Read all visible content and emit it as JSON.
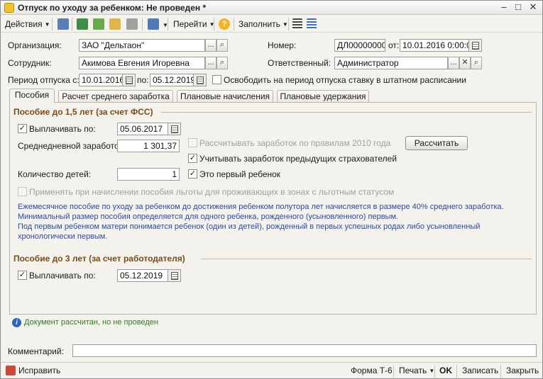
{
  "window": {
    "title": "Отпуск по уходу за ребенком: Не проведен *",
    "minimize": "–",
    "maximize": "□",
    "close": "✕"
  },
  "toolbar": {
    "actions_label": "Действия",
    "goto_label": "Перейти",
    "fill_label": "Заполнить",
    "help_glyph": "?"
  },
  "header": {
    "org_label": "Организация:",
    "org_value": "ЗАО \"Дельтаон\"",
    "number_label": "Номер:",
    "number_value": "ДЛ00000000",
    "from_label": "от:",
    "date_value": "10.01.2016  0:00:0",
    "employee_label": "Сотрудник:",
    "employee_value": "Акимова Евгения Игоревна",
    "responsible_label": "Ответственный:",
    "responsible_value": "Администратор",
    "period_label": "Период отпуска с:",
    "period_from": "10.01.2016",
    "period_to_label": "по:",
    "period_to": "05.12.2019",
    "release_rate_label": "Освободить на период отпуска ставку в штатном расписании",
    "dots": "...",
    "search_glyph": "⌕",
    "clear_glyph": "✕"
  },
  "tabs": [
    {
      "label": "Пособия"
    },
    {
      "label": "Расчет среднего заработка"
    },
    {
      "label": "Плановые начисления"
    },
    {
      "label": "Плановые удержания"
    }
  ],
  "benefit15": {
    "title": "Пособие до 1,5 лет (за счет ФСС)",
    "pay_until_label": "Выплачивать по:",
    "pay_until_value": "05.06.2017",
    "pay_checked": "✓",
    "calc_2010_label": "Рассчитывать заработок по правилам 2010 года",
    "calc_button": "Рассчитать",
    "avg_earnings_label": "Среднедневной заработок:",
    "avg_earnings_value": "1 301,37",
    "prev_insurers_label": "Учитывать заработок предыдущих страхователей",
    "prev_insurers_checked": "✓",
    "children_label": "Количество детей:",
    "children_value": "1",
    "first_child_label": "Это первый ребенок",
    "first_child_checked": "✓",
    "privilege_label": "Применять при начислении пособия льготы для проживающих в зонах с льготным статусом",
    "info_lines": [
      "Ежемесячное пособие по уходу за ребенком до достижения ребенком полутора лет начисляется в размере 40% среднего заработка.",
      "Минимальный размер пособия определяется для одного ребенка, рожденного (усыновленного) первым.",
      "Под первым ребенком матери понимается ребенок (один из детей), рожденный в первых успешных родах либо усыновленный",
      "хронологически первым."
    ]
  },
  "benefit3": {
    "title": "Пособие до 3 лет (за счет работодателя)",
    "pay_until_label": "Выплачивать по:",
    "pay_until_value": "05.12.2019",
    "pay_checked": "✓"
  },
  "status": {
    "icon_glyph": "i",
    "text": "Документ рассчитан, но не проведен"
  },
  "comment": {
    "label": "Комментарий:",
    "value": ""
  },
  "bottom": {
    "fix_label": "Исправить",
    "form_t6": "Форма Т-6",
    "print_label": "Печать",
    "ok_label": "OK",
    "save_label": "Записать",
    "close_label": "Закрыть"
  },
  "colors": {
    "accent": "#7a4b17",
    "info_text": "#2b4aa8",
    "status_green": "#2f7d1d"
  }
}
